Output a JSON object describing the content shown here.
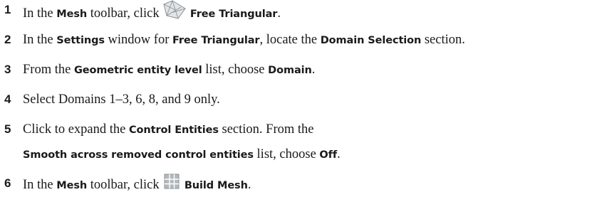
{
  "steps": [
    {
      "num": "1",
      "t1": "In the ",
      "b1": "Mesh",
      "t2": " toolbar, click ",
      "icon": "free-triangular-icon",
      "b2": "Free Triangular",
      "t3": "."
    },
    {
      "num": "2",
      "t1": "In the ",
      "b1": "Settings",
      "t2": " window for ",
      "b2": "Free Triangular",
      "t3": ", locate the ",
      "b3": "Domain Selection",
      "t4": " section."
    },
    {
      "num": "3",
      "t1": "From the ",
      "b1": "Geometric entity level",
      "t2": " list, choose ",
      "b2": "Domain",
      "t3": "."
    },
    {
      "num": "4",
      "t1": "Select Domains 1–3, 6, 8, and 9 only."
    },
    {
      "num": "5",
      "t1": "Click to expand the ",
      "b1": "Control Entities",
      "t2": " section. From the",
      "b2": "Smooth across removed control entities",
      "t3": " list, choose ",
      "b3": "Off",
      "t4": "."
    },
    {
      "num": "6",
      "t1": "In the ",
      "b1": "Mesh",
      "t2": " toolbar, click ",
      "icon": "build-mesh-icon",
      "b2": "Build Mesh",
      "t3": "."
    }
  ],
  "colors": {
    "text": "#1a1a1a",
    "icon_grey": "#b0b4b8",
    "icon_outline": "#8a9096"
  }
}
